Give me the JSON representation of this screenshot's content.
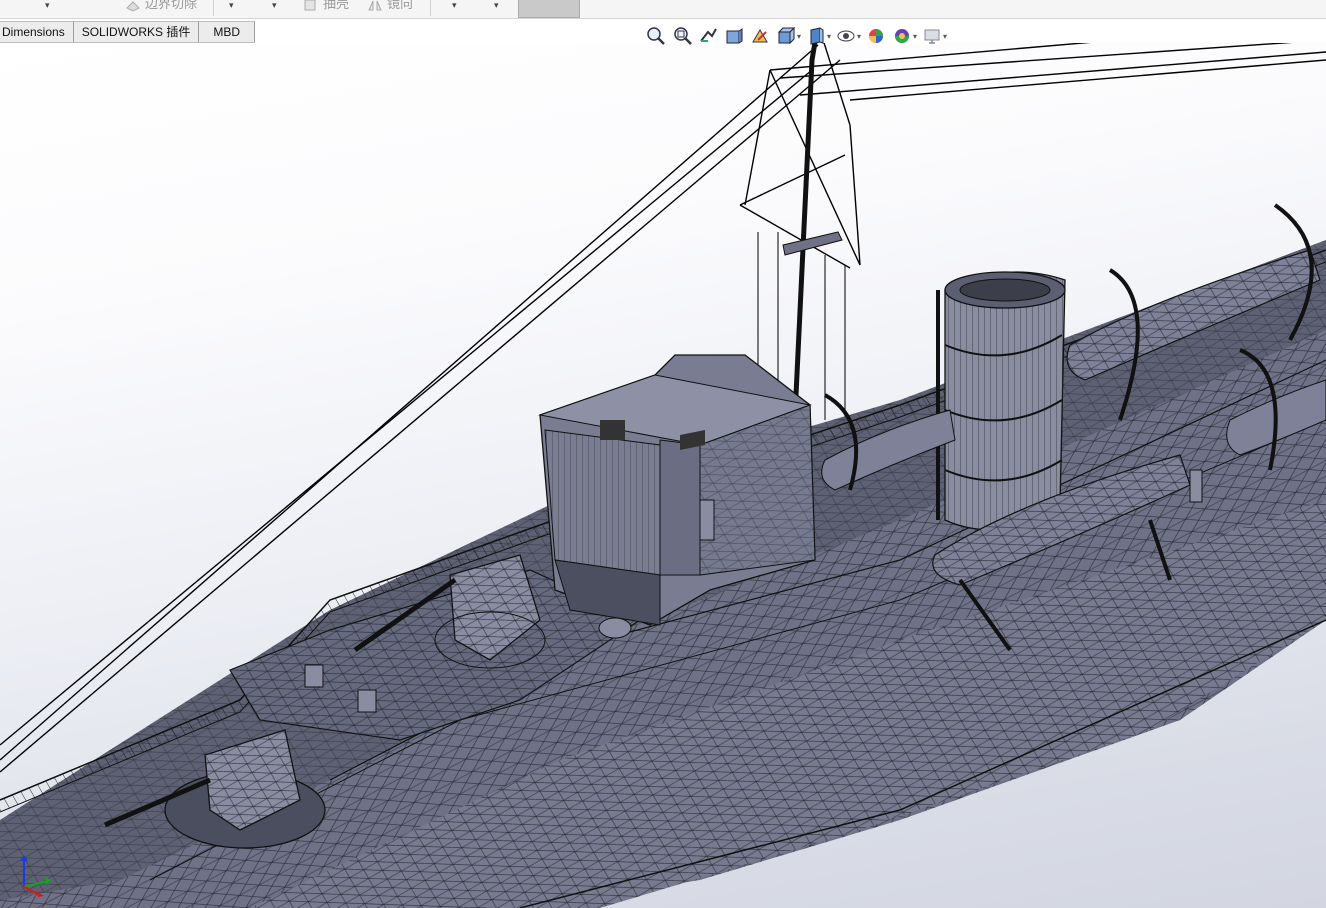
{
  "ribbon": {
    "items": [
      {
        "label": "边界切除",
        "icon": "boundary-cut-icon"
      },
      {
        "label": "抽壳",
        "icon": "shell-icon"
      },
      {
        "label": "镜向",
        "icon": "mirror-icon"
      }
    ]
  },
  "tabs": [
    {
      "label": "Dimensions"
    },
    {
      "label": "SOLIDWORKS 插件"
    },
    {
      "label": "MBD"
    }
  ],
  "view_toolbar": [
    {
      "icon": "zoom-to-fit-icon"
    },
    {
      "icon": "zoom-to-area-icon"
    },
    {
      "icon": "previous-view-icon"
    },
    {
      "icon": "section-view-icon"
    },
    {
      "icon": "dynamic-annotation-views-icon"
    },
    {
      "icon": "view-orientation-icon"
    },
    {
      "icon": "display-style-icon"
    },
    {
      "icon": "hide-show-items-icon"
    },
    {
      "icon": "edit-appearance-icon"
    },
    {
      "icon": "apply-scene-icon"
    },
    {
      "icon": "view-settings-icon"
    }
  ],
  "colors": {
    "hull": "#6f7287",
    "hull_light": "#8e91a6",
    "deck": "#5e6174",
    "wire": "#000000",
    "background_top": "#ffffff",
    "background_bottom": "#d3d6e1"
  },
  "triad": {
    "axes": [
      "x-red",
      "y-green",
      "z-blue"
    ]
  }
}
